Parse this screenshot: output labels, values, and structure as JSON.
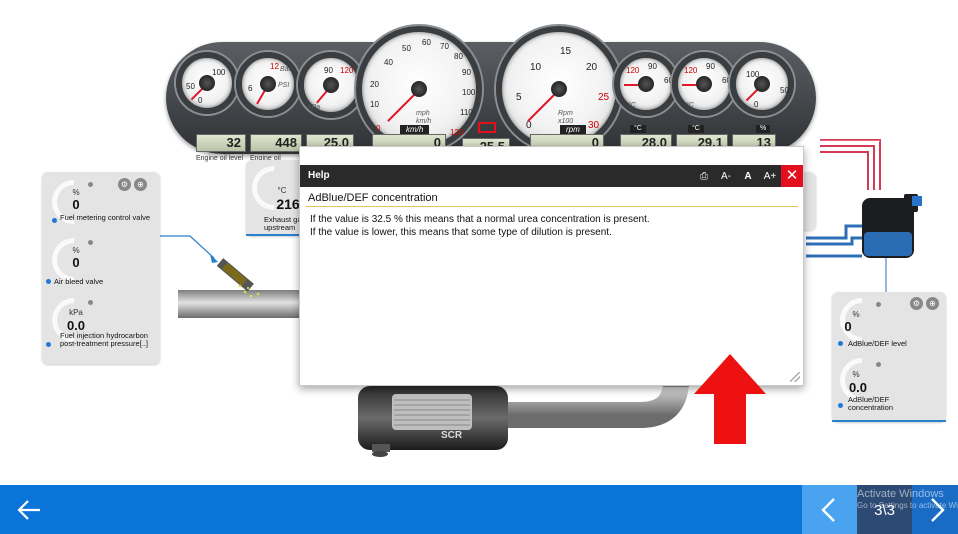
{
  "dashboard": {
    "gauges": {
      "oil_temp": {
        "unit": "%",
        "ticks": [
          "100",
          "50",
          "0"
        ]
      },
      "oil_pressure": {
        "unit": "PSI",
        "ticks": [
          "12",
          "Bar",
          "6",
          "0"
        ]
      },
      "turbo": {
        "unit": "kPa",
        "ticks": [
          "120",
          "90"
        ]
      },
      "speed": {
        "unit": "mph",
        "unit2": "km/h",
        "ticks": [
          "40",
          "50",
          "60",
          "70",
          "80",
          "90",
          "100",
          "110",
          "120",
          "20",
          "10",
          "0"
        ]
      },
      "rpm": {
        "unit": "Rpm",
        "unit2": "x100",
        "ticks": [
          "10",
          "15",
          "20",
          "25",
          "30",
          "5",
          "0"
        ]
      },
      "coolant": {
        "unit": "°C",
        "ticks": [
          "120",
          "90",
          "60"
        ]
      },
      "fuel_temp": {
        "unit": "°C",
        "ticks": [
          "120",
          "90",
          "60"
        ]
      },
      "fuel_level": {
        "unit": "%",
        "ticks": [
          "100",
          "50",
          "0"
        ]
      }
    },
    "readouts": {
      "r1": "32",
      "r2": "448",
      "r3": "25.0",
      "r4": "0",
      "r5": "25.5",
      "r6": "0",
      "r7": "28.0",
      "r8": "29.1",
      "r9": "13"
    },
    "readout_units": {
      "r3": "°C",
      "r4": "km/h",
      "r6": "rpm",
      "r7": "°C",
      "r8": "°C",
      "r9": "%"
    },
    "readout_labels": {
      "r1": "Engine oil level",
      "r2": "Engine oil pressure"
    }
  },
  "left_panel": {
    "sensors": [
      {
        "unit": "%",
        "value": "0",
        "label": "Fuel metering control valve"
      },
      {
        "unit": "%",
        "value": "0",
        "label": "Air bleed valve"
      },
      {
        "unit": "kPa",
        "value": "0.0",
        "label": "Fuel injection hydrocarbon post-treatment pressure[..]"
      }
    ]
  },
  "middle_panel": {
    "unit": "°C",
    "value": "216",
    "label": "Exhaust gas upstream"
  },
  "right_panel": {
    "sensors": [
      {
        "unit": "%",
        "value": "0",
        "label": "AdBlue/DEF level"
      },
      {
        "unit": "%",
        "value": "0.0",
        "label": "AdBlue/DEF concentration"
      }
    ]
  },
  "scr_label": "SCR",
  "help_dialog": {
    "title": "Help",
    "tools": {
      "print": "⎙",
      "decrease": "A-",
      "normal": "A",
      "increase": "A+",
      "close": "✕"
    },
    "heading": "AdBlue/DEF concentration",
    "lines": [
      "If the value is 32.5 % this means that a normal urea concentration is present.",
      "If the value is lower, this means that some type of dilution is present."
    ]
  },
  "bottom_bar": {
    "page_indicator": "3\\3",
    "watermark_title": "Activate Windows",
    "watermark_sub": "Go to Settings to activate Windows."
  },
  "colors": {
    "accent": "#0a74d8",
    "alert_arrow": "#ee1111",
    "close_red": "#e2101e"
  }
}
